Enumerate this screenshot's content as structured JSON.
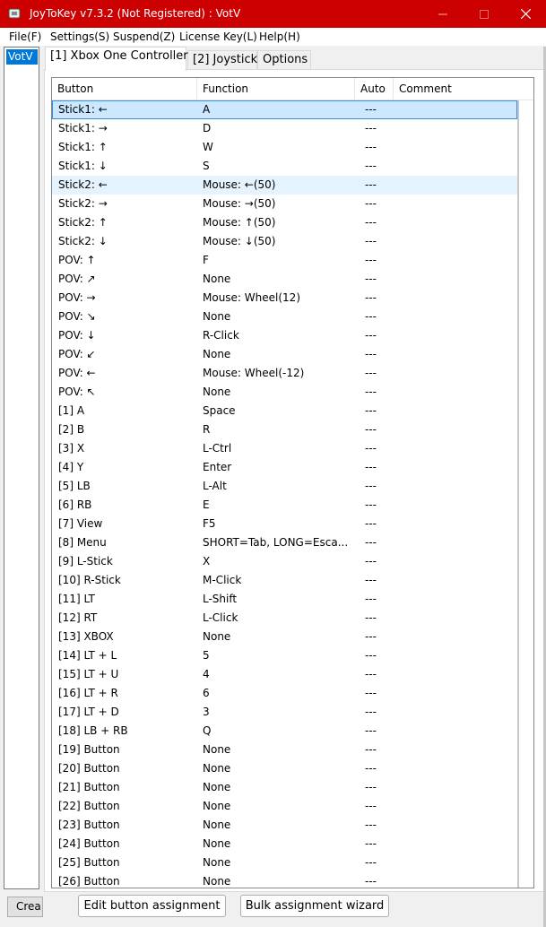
{
  "window": {
    "title": "JoyToKey v7.3.2 (Not Registered) : VotV",
    "title_color": "#cc0000",
    "controls": [
      "minimize-icon",
      "maximize-icon",
      "close-icon"
    ]
  },
  "menubar": {
    "items": [
      "File(F)",
      "Settings(S)",
      "Suspend(Z)",
      "License Key(L)",
      "Help(H)"
    ]
  },
  "config_list": {
    "items": [
      "VotV"
    ],
    "selected": "VotV",
    "create_button_label": "Crea"
  },
  "tabs": [
    {
      "label": "[1] Xbox One Controller",
      "active": true
    },
    {
      "label": "[2] Joystick",
      "active": false
    },
    {
      "label": "Options",
      "active": false
    }
  ],
  "table": {
    "columns": [
      "Button",
      "Function",
      "Auto",
      "Comment"
    ],
    "rows": [
      {
        "button": "Stick1: ←",
        "function": "A",
        "auto": "---",
        "comment": "",
        "state": "selected"
      },
      {
        "button": "Stick1: →",
        "function": "D",
        "auto": "---",
        "comment": ""
      },
      {
        "button": "Stick1: ↑",
        "function": "W",
        "auto": "---",
        "comment": ""
      },
      {
        "button": "Stick1: ↓",
        "function": "S",
        "auto": "---",
        "comment": ""
      },
      {
        "button": "Stick2: ←",
        "function": "Mouse: ←(50)",
        "auto": "---",
        "comment": "",
        "state": "hover"
      },
      {
        "button": "Stick2: →",
        "function": "Mouse: →(50)",
        "auto": "---",
        "comment": ""
      },
      {
        "button": "Stick2: ↑",
        "function": "Mouse: ↑(50)",
        "auto": "---",
        "comment": ""
      },
      {
        "button": "Stick2: ↓",
        "function": "Mouse: ↓(50)",
        "auto": "---",
        "comment": ""
      },
      {
        "button": "POV: ↑",
        "function": "F",
        "auto": "---",
        "comment": ""
      },
      {
        "button": "POV: ↗",
        "function": "None",
        "auto": "---",
        "comment": ""
      },
      {
        "button": "POV: →",
        "function": "Mouse: Wheel(12)",
        "auto": "---",
        "comment": ""
      },
      {
        "button": "POV: ↘",
        "function": "None",
        "auto": "---",
        "comment": ""
      },
      {
        "button": "POV: ↓",
        "function": "R-Click",
        "auto": "---",
        "comment": ""
      },
      {
        "button": "POV: ↙",
        "function": "None",
        "auto": "---",
        "comment": ""
      },
      {
        "button": "POV: ←",
        "function": "Mouse: Wheel(-12)",
        "auto": "---",
        "comment": ""
      },
      {
        "button": "POV: ↖",
        "function": "None",
        "auto": "---",
        "comment": ""
      },
      {
        "button": "[1] A",
        "function": "Space",
        "auto": "---",
        "comment": ""
      },
      {
        "button": "[2] B",
        "function": "R",
        "auto": "---",
        "comment": ""
      },
      {
        "button": "[3] X",
        "function": "L-Ctrl",
        "auto": "---",
        "comment": ""
      },
      {
        "button": "[4] Y",
        "function": "Enter",
        "auto": "---",
        "comment": ""
      },
      {
        "button": "[5] LB",
        "function": "L-Alt",
        "auto": "---",
        "comment": ""
      },
      {
        "button": "[6] RB",
        "function": "E",
        "auto": "---",
        "comment": ""
      },
      {
        "button": "[7] View",
        "function": "F5",
        "auto": "---",
        "comment": ""
      },
      {
        "button": "[8] Menu",
        "function": "SHORT=Tab, LONG=Esca...",
        "auto": "---",
        "comment": ""
      },
      {
        "button": "[9] L-Stick",
        "function": "X",
        "auto": "---",
        "comment": ""
      },
      {
        "button": "[10] R-Stick",
        "function": "M-Click",
        "auto": "---",
        "comment": ""
      },
      {
        "button": "[11] LT",
        "function": "L-Shift",
        "auto": "---",
        "comment": ""
      },
      {
        "button": "[12] RT",
        "function": "L-Click",
        "auto": "---",
        "comment": ""
      },
      {
        "button": "[13] XBOX",
        "function": "None",
        "auto": "---",
        "comment": ""
      },
      {
        "button": "[14] LT + L",
        "function": "5",
        "auto": "---",
        "comment": ""
      },
      {
        "button": "[15] LT + U",
        "function": "4",
        "auto": "---",
        "comment": ""
      },
      {
        "button": "[16] LT + R",
        "function": "6",
        "auto": "---",
        "comment": ""
      },
      {
        "button": "[17] LT + D",
        "function": "3",
        "auto": "---",
        "comment": ""
      },
      {
        "button": "[18] LB + RB",
        "function": "Q",
        "auto": "---",
        "comment": ""
      },
      {
        "button": "[19] Button",
        "function": "None",
        "auto": "---",
        "comment": ""
      },
      {
        "button": "[20] Button",
        "function": "None",
        "auto": "---",
        "comment": ""
      },
      {
        "button": "[21] Button",
        "function": "None",
        "auto": "---",
        "comment": ""
      },
      {
        "button": "[22] Button",
        "function": "None",
        "auto": "---",
        "comment": ""
      },
      {
        "button": "[23] Button",
        "function": "None",
        "auto": "---",
        "comment": ""
      },
      {
        "button": "[24] Button",
        "function": "None",
        "auto": "---",
        "comment": ""
      },
      {
        "button": "[25] Button",
        "function": "None",
        "auto": "---",
        "comment": ""
      },
      {
        "button": "[26] Button",
        "function": "None",
        "auto": "---",
        "comment": ""
      }
    ]
  },
  "buttons": {
    "edit": "Edit button assignment",
    "bulk": "Bulk assignment wizard"
  }
}
